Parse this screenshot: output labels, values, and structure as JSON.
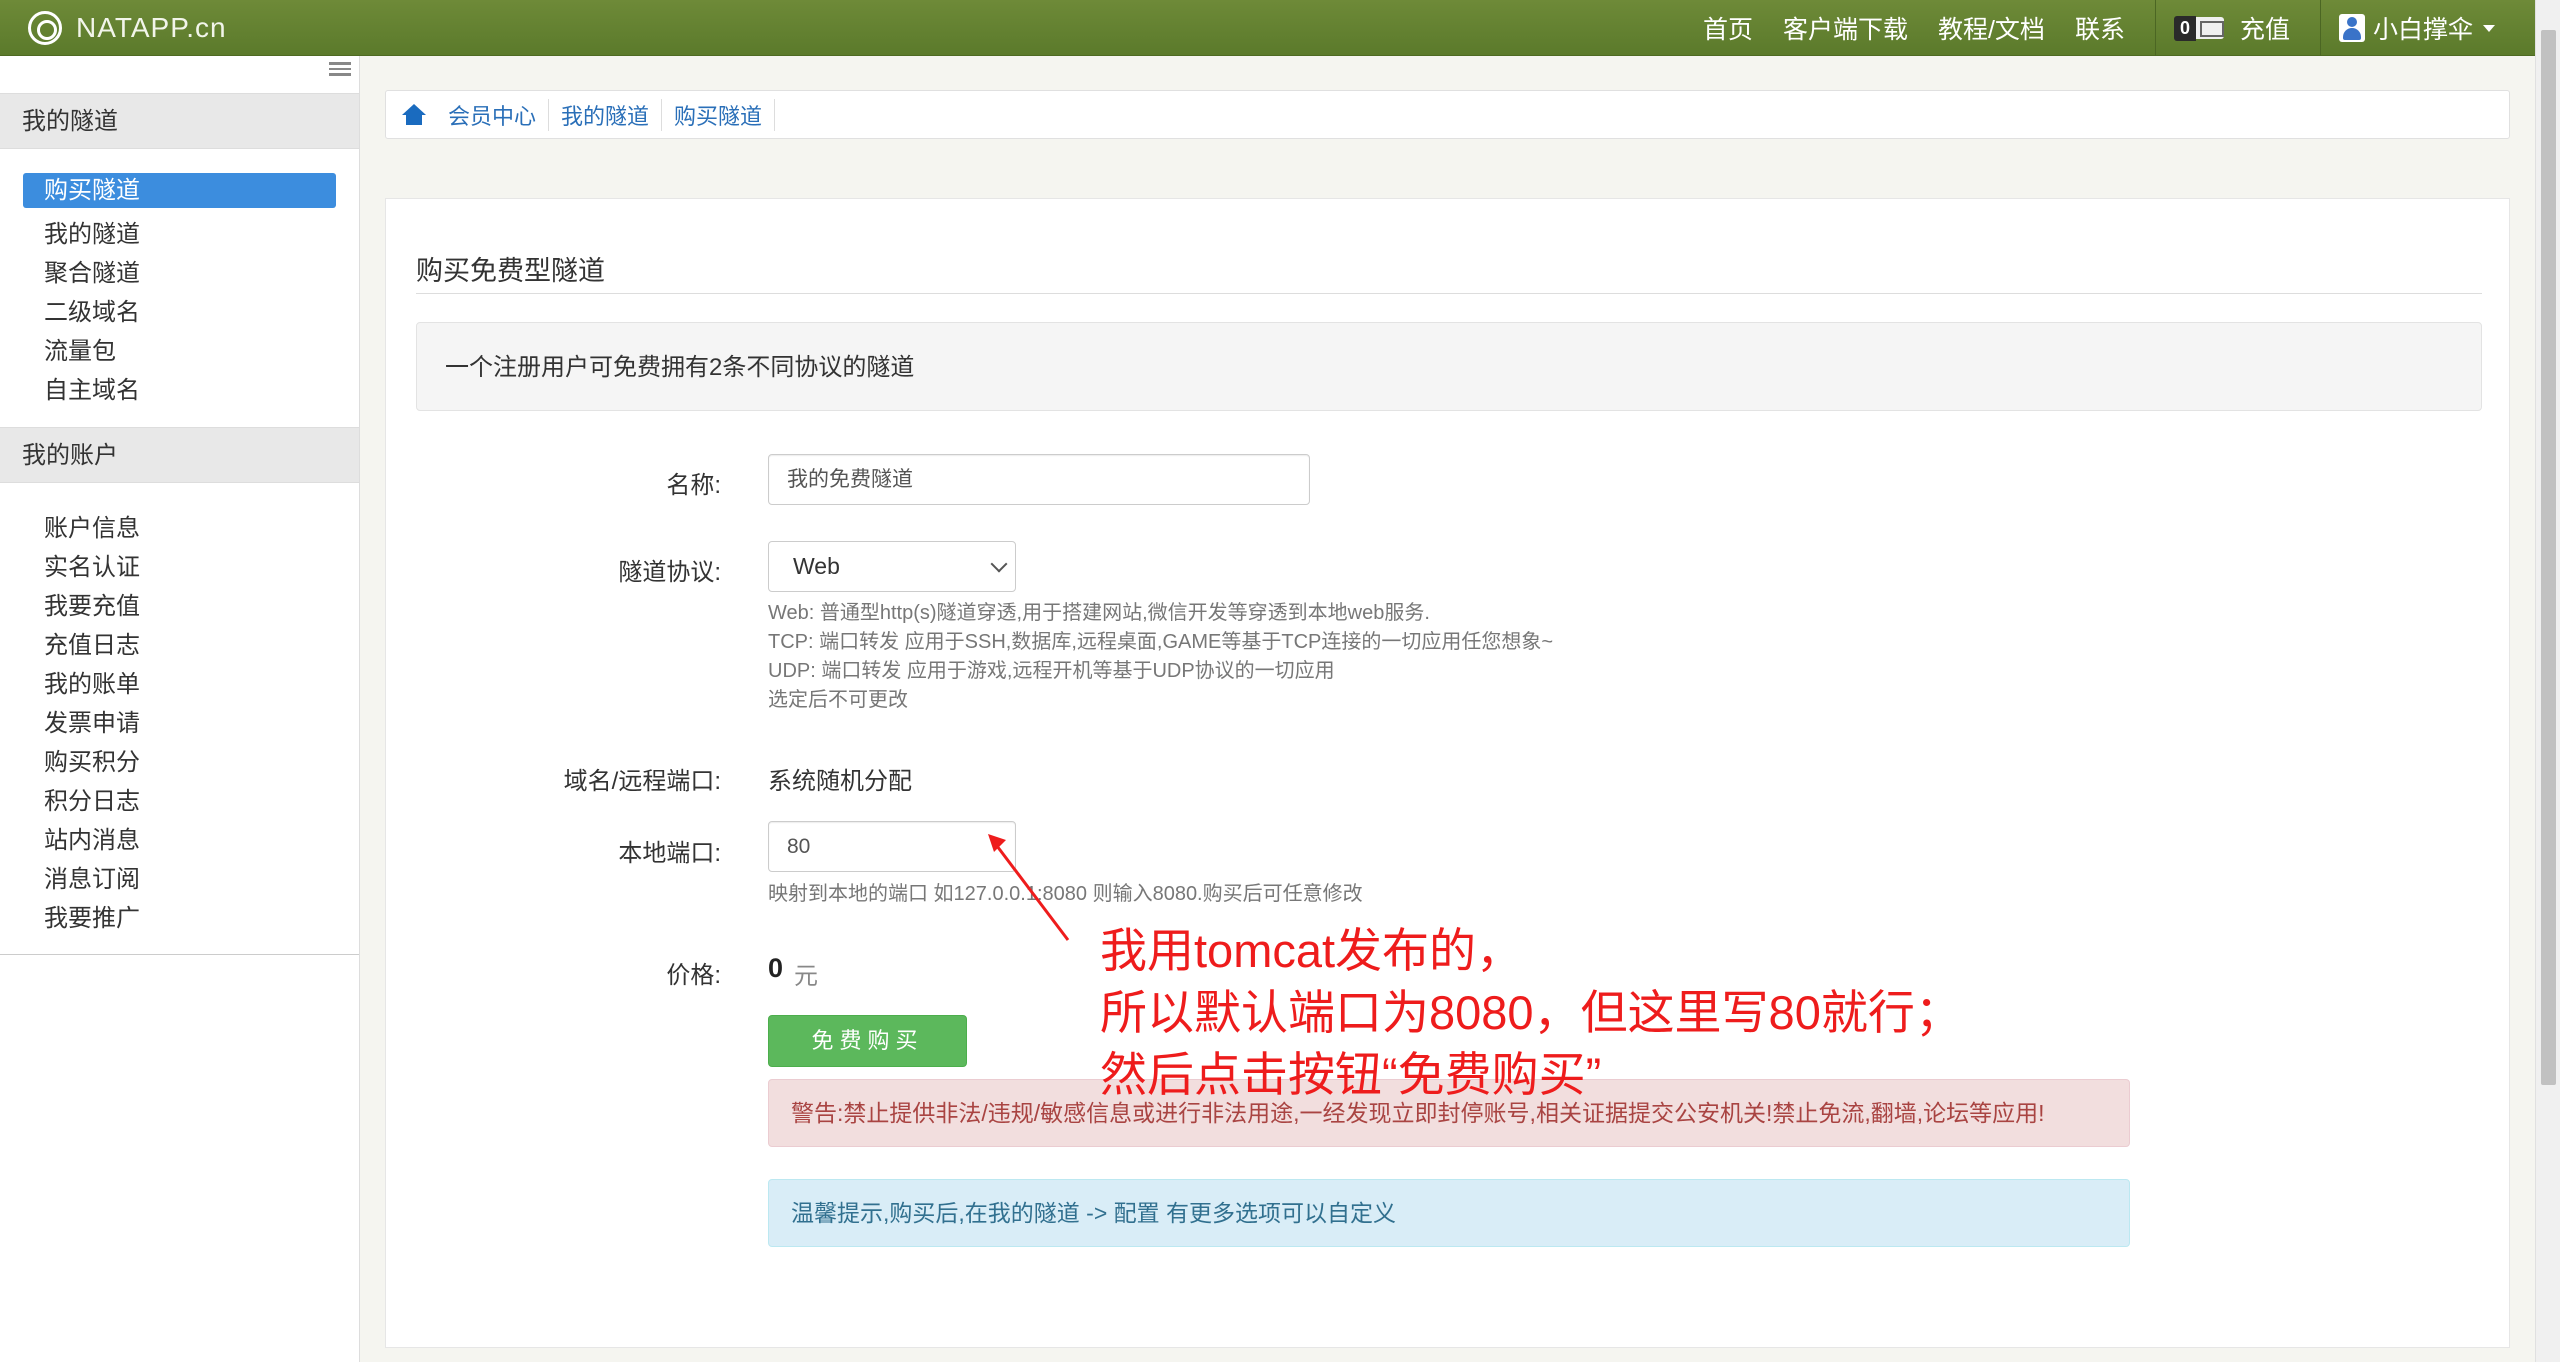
{
  "navbar": {
    "brand": "NATAPP.cn",
    "links": [
      "首页",
      "客户端下载",
      "教程/文档",
      "联系"
    ],
    "message_count": "0",
    "recharge": "充值",
    "username": "小白撑伞"
  },
  "sidebar": {
    "group1_title": "我的隧道",
    "group1_items": [
      "购买隧道",
      "我的隧道",
      "聚合隧道",
      "二级域名",
      "流量包",
      "自主域名"
    ],
    "group2_title": "我的账户",
    "group2_items": [
      "账户信息",
      "实名认证",
      "我要充值",
      "充值日志",
      "我的账单",
      "发票申请",
      "购买积分",
      "积分日志",
      "站内消息",
      "消息订阅",
      "我要推广"
    ]
  },
  "breadcrumb": [
    "会员中心",
    "我的隧道",
    "购买隧道"
  ],
  "form": {
    "title": "购买免费型隧道",
    "notice": "一个注册用户可免费拥有2条不同协议的隧道",
    "name_label": "名称:",
    "name_value": "我的免费隧道",
    "protocol_label": "隧道协议:",
    "protocol_value": "Web",
    "protocol_help": [
      "Web: 普通型http(s)隧道穿透,用于搭建网站,微信开发等穿透到本地web服务.",
      "TCP: 端口转发 应用于SSH,数据库,远程桌面,GAME等基于TCP连接的一切应用任您想象~",
      "UDP: 端口转发 应用于游戏,远程开机等基于UDP协议的一切应用",
      "选定后不可更改"
    ],
    "domain_label": "域名/远程端口:",
    "domain_value": "系统随机分配",
    "port_label": "本地端口:",
    "port_value": "80",
    "port_help": "映射到本地的端口 如127.0.0.1:8080 则输入8080.购买后可任意修改",
    "price_label": "价格:",
    "price_value": "0",
    "price_unit": "元",
    "buy_button": "免费购买",
    "warning": "警告:禁止提供非法/违规/敏感信息或进行非法用途,一经发现立即封停账号,相关证据提交公安机关!禁止免流,翻墙,论坛等应用!",
    "tip": "温馨提示,购买后,在我的隧道 -> 配置 有更多选项可以自定义"
  },
  "annotation": {
    "lines": [
      "我用tomcat发布的，",
      "所以默认端口为8080，但这里写80就行；",
      "然后点击按钮“免费购买”"
    ],
    "color": "#ee1c1c"
  },
  "colors": {
    "navbar": "#5b7a2b",
    "active_item": "#3c8dde",
    "buy_button": "#5cb85c"
  }
}
